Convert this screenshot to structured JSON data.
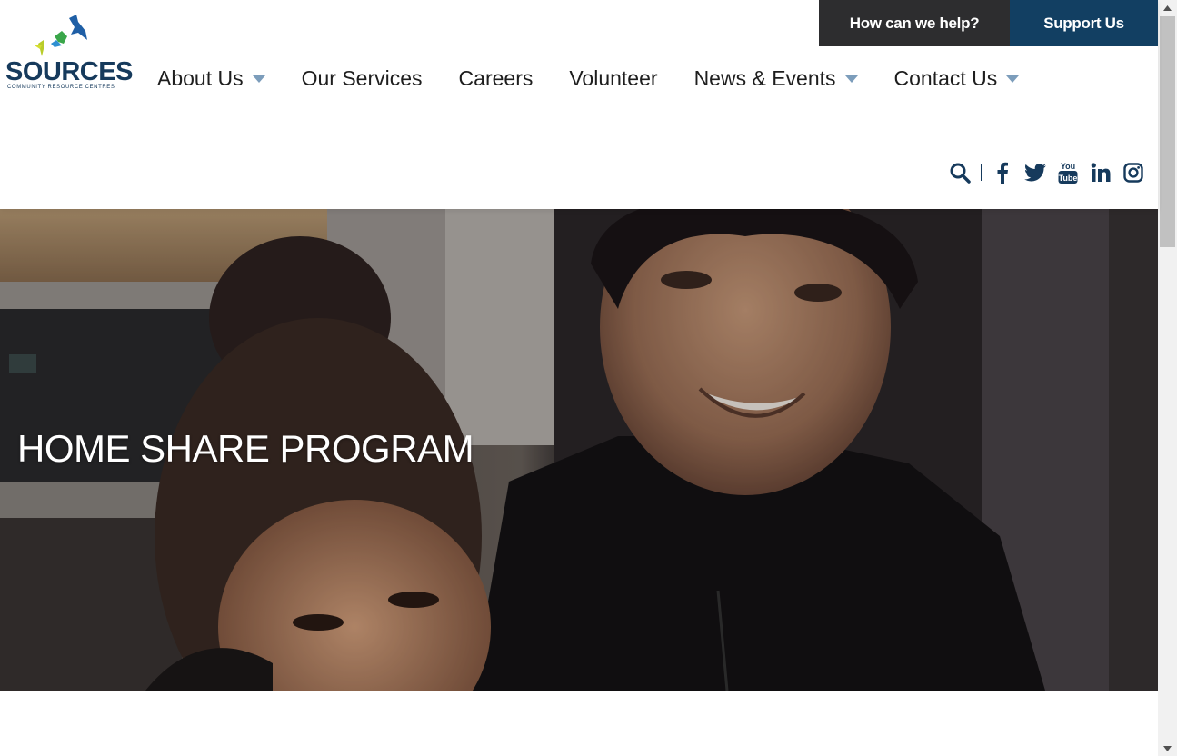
{
  "brand": {
    "name": "SOURCES",
    "tagline": "COMMUNITY RESOURCE CENTRES"
  },
  "topbar": {
    "help_label": "How can we help?",
    "support_label": "Support Us"
  },
  "nav": {
    "items": [
      {
        "label": "About Us",
        "has_dropdown": true
      },
      {
        "label": "Our Services",
        "has_dropdown": false
      },
      {
        "label": "Careers",
        "has_dropdown": false
      },
      {
        "label": "Volunteer",
        "has_dropdown": false
      },
      {
        "label": "News & Events",
        "has_dropdown": true
      },
      {
        "label": "Contact Us",
        "has_dropdown": true
      }
    ]
  },
  "social": {
    "icons": [
      "search-icon",
      "facebook-icon",
      "twitter-icon",
      "youtube-icon",
      "linkedin-icon",
      "instagram-icon"
    ],
    "youtube_top": "You",
    "youtube_bottom": "Tube"
  },
  "hero": {
    "title": "HOME SHARE PROGRAM"
  },
  "colors": {
    "brand_navy": "#123f62",
    "dark_button": "#2d2d2f",
    "caret": "#7c9dbb",
    "text": "#1e1e1e"
  }
}
